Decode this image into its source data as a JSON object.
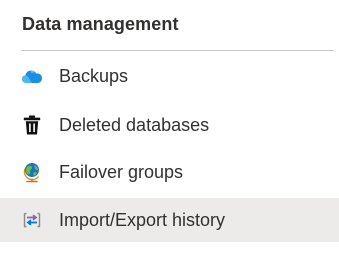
{
  "section": {
    "title": "Data management"
  },
  "nav": {
    "items": [
      {
        "label": "Backups",
        "icon": "cloud-backup-icon"
      },
      {
        "label": "Deleted databases",
        "icon": "trash-icon"
      },
      {
        "label": "Failover groups",
        "icon": "globe-icon"
      },
      {
        "label": "Import/Export history",
        "icon": "import-export-icon",
        "selected": true
      }
    ]
  },
  "colors": {
    "selected_background": "#edebe9",
    "text": "#323130",
    "divider": "#c8c6c4",
    "accent_blue": "#0078d4",
    "accent_purple": "#8661c5"
  }
}
